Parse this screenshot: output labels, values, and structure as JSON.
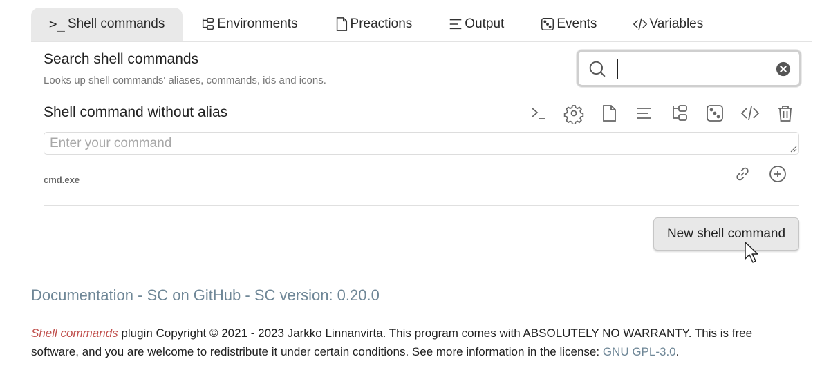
{
  "tabs": [
    {
      "label": "Shell commands",
      "icon": "terminal-icon",
      "active": true
    },
    {
      "label": "Environments",
      "icon": "tree-icon",
      "active": false
    },
    {
      "label": "Preactions",
      "icon": "file-icon",
      "active": false
    },
    {
      "label": "Output",
      "icon": "lines-icon",
      "active": false
    },
    {
      "label": "Events",
      "icon": "dice-icon",
      "active": false
    },
    {
      "label": "Variables",
      "icon": "code-icon",
      "active": false
    }
  ],
  "search": {
    "title": "Search shell commands",
    "description": "Looks up shell commands' aliases, commands, ids and icons.",
    "value": "",
    "placeholder": ""
  },
  "command": {
    "title": "Shell command without alias",
    "input_value": "",
    "placeholder": "Enter your command",
    "shell": "cmd.exe"
  },
  "new_button": "New shell command",
  "links": {
    "documentation": "Documentation",
    "sep1": " - ",
    "github": "SC on GitHub",
    "sep2": " - ",
    "version": "SC version: 0.20.0"
  },
  "footer": {
    "plugin_name": "Shell commands",
    "text": " plugin Copyright © 2021 - 2023 Jarkko Linnanvirta. This program comes with ABSOLUTELY NO WARRANTY. This is free software, and you are welcome to redistribute it under certain conditions. See more information in the license: ",
    "license": "GNU GPL-3.0",
    "end": "."
  },
  "colors": {
    "link": "#6f8797",
    "plugin_name": "#c0504d",
    "active_tab": "#e9e9e9"
  }
}
